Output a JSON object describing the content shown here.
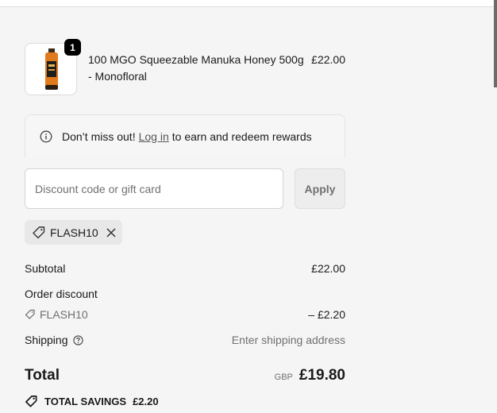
{
  "line_item": {
    "quantity": "1",
    "name": "100 MGO Squeezable Manuka Honey 500g - Monofloral",
    "price": "£22.00"
  },
  "rewards": {
    "prefix": "Don’t miss out!",
    "link": "Log in",
    "suffix": "to earn and redeem rewards"
  },
  "discount": {
    "placeholder": "Discount code or gift card",
    "apply_label": "Apply",
    "applied_code": "FLASH10"
  },
  "summary": {
    "subtotal_label": "Subtotal",
    "subtotal_value": "£22.00",
    "order_discount_label": "Order discount",
    "discount_code": "FLASH10",
    "discount_value": "– £2.20",
    "shipping_label": "Shipping",
    "shipping_value": "Enter shipping address",
    "total_label": "Total",
    "currency": "GBP",
    "total_value": "£19.80",
    "savings_label": "TOTAL SAVINGS",
    "savings_value": "£2.20"
  },
  "colors": {
    "background": "#f5f5f5",
    "text": "#1a1a1a",
    "muted": "#707070",
    "product_orange": "#e07a1c"
  },
  "icons": {
    "info": "info-icon",
    "tag": "tag-icon",
    "close": "close-icon",
    "help": "question-circle-icon",
    "savings": "tag-icon"
  }
}
